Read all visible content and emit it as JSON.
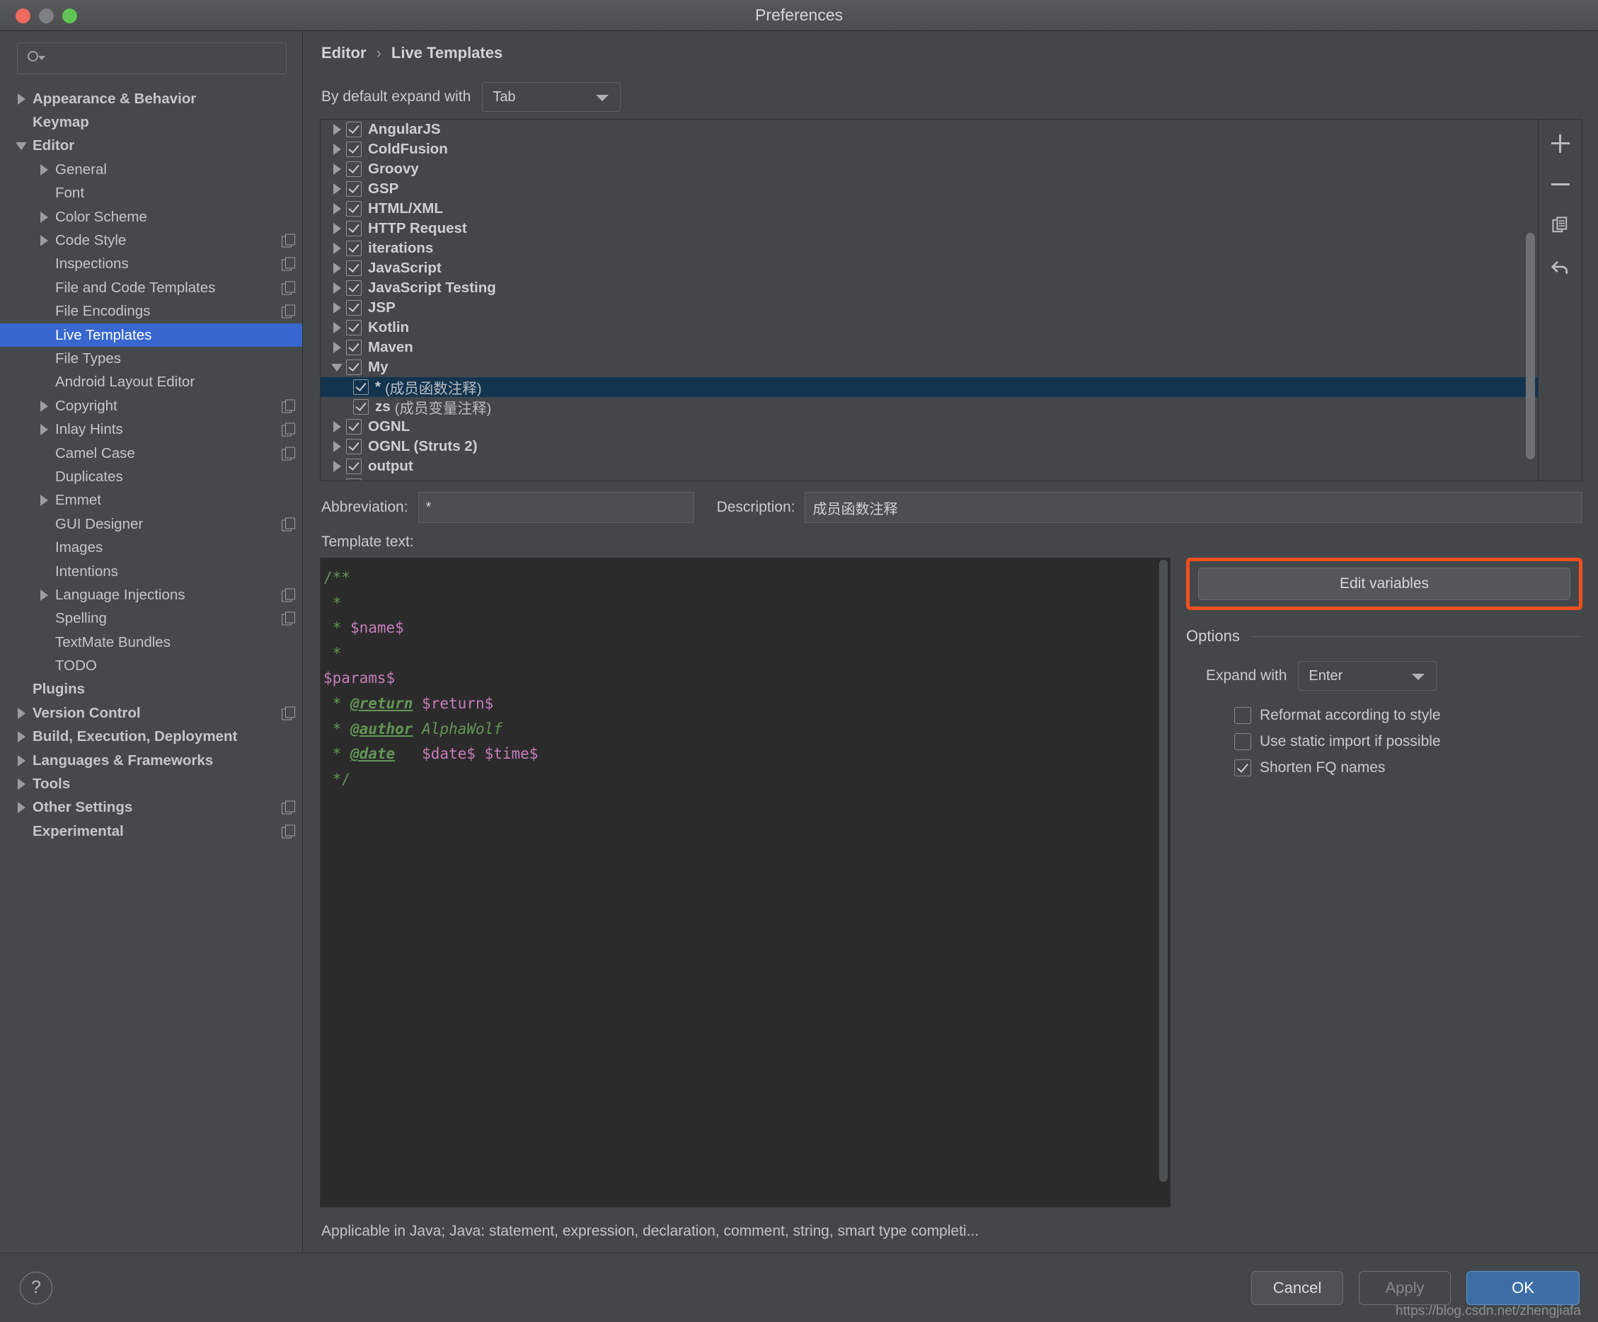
{
  "window": {
    "title": "Preferences",
    "traffic": [
      "close",
      "minimize",
      "zoom"
    ]
  },
  "sidebar": {
    "search": {
      "value": "",
      "placeholder": ""
    },
    "items": [
      {
        "label": "Appearance & Behavior",
        "indent": 0,
        "arrow": "right",
        "bold": true,
        "copy": false,
        "selected": false
      },
      {
        "label": "Keymap",
        "indent": 0,
        "arrow": "none",
        "bold": true,
        "copy": false,
        "selected": false
      },
      {
        "label": "Editor",
        "indent": 0,
        "arrow": "down",
        "bold": true,
        "copy": false,
        "selected": false
      },
      {
        "label": "General",
        "indent": 1,
        "arrow": "right",
        "bold": false,
        "copy": false,
        "selected": false
      },
      {
        "label": "Font",
        "indent": 1,
        "arrow": "none",
        "bold": false,
        "copy": false,
        "selected": false
      },
      {
        "label": "Color Scheme",
        "indent": 1,
        "arrow": "right",
        "bold": false,
        "copy": false,
        "selected": false
      },
      {
        "label": "Code Style",
        "indent": 1,
        "arrow": "right",
        "bold": false,
        "copy": true,
        "selected": false
      },
      {
        "label": "Inspections",
        "indent": 1,
        "arrow": "none",
        "bold": false,
        "copy": true,
        "selected": false
      },
      {
        "label": "File and Code Templates",
        "indent": 1,
        "arrow": "none",
        "bold": false,
        "copy": true,
        "selected": false
      },
      {
        "label": "File Encodings",
        "indent": 1,
        "arrow": "none",
        "bold": false,
        "copy": true,
        "selected": false
      },
      {
        "label": "Live Templates",
        "indent": 1,
        "arrow": "none",
        "bold": false,
        "copy": false,
        "selected": true
      },
      {
        "label": "File Types",
        "indent": 1,
        "arrow": "none",
        "bold": false,
        "copy": false,
        "selected": false
      },
      {
        "label": "Android Layout Editor",
        "indent": 1,
        "arrow": "none",
        "bold": false,
        "copy": false,
        "selected": false
      },
      {
        "label": "Copyright",
        "indent": 1,
        "arrow": "right",
        "bold": false,
        "copy": true,
        "selected": false
      },
      {
        "label": "Inlay Hints",
        "indent": 1,
        "arrow": "right",
        "bold": false,
        "copy": true,
        "selected": false
      },
      {
        "label": "Camel Case",
        "indent": 1,
        "arrow": "none",
        "bold": false,
        "copy": true,
        "selected": false
      },
      {
        "label": "Duplicates",
        "indent": 1,
        "arrow": "none",
        "bold": false,
        "copy": false,
        "selected": false
      },
      {
        "label": "Emmet",
        "indent": 1,
        "arrow": "right",
        "bold": false,
        "copy": false,
        "selected": false
      },
      {
        "label": "GUI Designer",
        "indent": 1,
        "arrow": "none",
        "bold": false,
        "copy": true,
        "selected": false
      },
      {
        "label": "Images",
        "indent": 1,
        "arrow": "none",
        "bold": false,
        "copy": false,
        "selected": false
      },
      {
        "label": "Intentions",
        "indent": 1,
        "arrow": "none",
        "bold": false,
        "copy": false,
        "selected": false
      },
      {
        "label": "Language Injections",
        "indent": 1,
        "arrow": "right",
        "bold": false,
        "copy": true,
        "selected": false
      },
      {
        "label": "Spelling",
        "indent": 1,
        "arrow": "none",
        "bold": false,
        "copy": true,
        "selected": false
      },
      {
        "label": "TextMate Bundles",
        "indent": 1,
        "arrow": "none",
        "bold": false,
        "copy": false,
        "selected": false
      },
      {
        "label": "TODO",
        "indent": 1,
        "arrow": "none",
        "bold": false,
        "copy": false,
        "selected": false
      },
      {
        "label": "Plugins",
        "indent": 0,
        "arrow": "none",
        "bold": true,
        "copy": false,
        "selected": false
      },
      {
        "label": "Version Control",
        "indent": 0,
        "arrow": "right",
        "bold": true,
        "copy": true,
        "selected": false
      },
      {
        "label": "Build, Execution, Deployment",
        "indent": 0,
        "arrow": "right",
        "bold": true,
        "copy": false,
        "selected": false
      },
      {
        "label": "Languages & Frameworks",
        "indent": 0,
        "arrow": "right",
        "bold": true,
        "copy": false,
        "selected": false
      },
      {
        "label": "Tools",
        "indent": 0,
        "arrow": "right",
        "bold": true,
        "copy": false,
        "selected": false
      },
      {
        "label": "Other Settings",
        "indent": 0,
        "arrow": "right",
        "bold": true,
        "copy": true,
        "selected": false
      },
      {
        "label": "Experimental",
        "indent": 0,
        "arrow": "none",
        "bold": true,
        "copy": true,
        "selected": false
      }
    ]
  },
  "breadcrumb": {
    "parent": "Editor",
    "separator": "›",
    "current": "Live Templates"
  },
  "expand_default": {
    "label": "By default expand with",
    "value": "Tab"
  },
  "template_list": {
    "rows": [
      {
        "label": "AngularJS",
        "desc": "",
        "arrow": "right",
        "checked": true,
        "child": false,
        "selected": false
      },
      {
        "label": "ColdFusion",
        "desc": "",
        "arrow": "right",
        "checked": true,
        "child": false,
        "selected": false
      },
      {
        "label": "Groovy",
        "desc": "",
        "arrow": "right",
        "checked": true,
        "child": false,
        "selected": false
      },
      {
        "label": "GSP",
        "desc": "",
        "arrow": "right",
        "checked": true,
        "child": false,
        "selected": false
      },
      {
        "label": "HTML/XML",
        "desc": "",
        "arrow": "right",
        "checked": true,
        "child": false,
        "selected": false
      },
      {
        "label": "HTTP Request",
        "desc": "",
        "arrow": "right",
        "checked": true,
        "child": false,
        "selected": false
      },
      {
        "label": "iterations",
        "desc": "",
        "arrow": "right",
        "checked": true,
        "child": false,
        "selected": false
      },
      {
        "label": "JavaScript",
        "desc": "",
        "arrow": "right",
        "checked": true,
        "child": false,
        "selected": false
      },
      {
        "label": "JavaScript Testing",
        "desc": "",
        "arrow": "right",
        "checked": true,
        "child": false,
        "selected": false
      },
      {
        "label": "JSP",
        "desc": "",
        "arrow": "right",
        "checked": true,
        "child": false,
        "selected": false
      },
      {
        "label": "Kotlin",
        "desc": "",
        "arrow": "right",
        "checked": true,
        "child": false,
        "selected": false
      },
      {
        "label": "Maven",
        "desc": "",
        "arrow": "right",
        "checked": true,
        "child": false,
        "selected": false
      },
      {
        "label": "My",
        "desc": "",
        "arrow": "down",
        "checked": true,
        "child": false,
        "selected": false
      },
      {
        "label": "*",
        "desc": "(成员函数注释)",
        "arrow": "none",
        "checked": true,
        "child": true,
        "selected": true
      },
      {
        "label": "zs",
        "desc": "(成员变量注释)",
        "arrow": "none",
        "checked": true,
        "child": true,
        "selected": false
      },
      {
        "label": "OGNL",
        "desc": "",
        "arrow": "right",
        "checked": true,
        "child": false,
        "selected": false
      },
      {
        "label": "OGNL (Struts 2)",
        "desc": "",
        "arrow": "right",
        "checked": true,
        "child": false,
        "selected": false
      },
      {
        "label": "output",
        "desc": "",
        "arrow": "right",
        "checked": true,
        "child": false,
        "selected": false
      }
    ],
    "tools": [
      "add-icon",
      "remove-icon",
      "duplicate-icon",
      "revert-icon"
    ]
  },
  "abbreviation": {
    "label": "Abbreviation:",
    "value": "*"
  },
  "description": {
    "label": "Description:",
    "value": "成员函数注释"
  },
  "template_text": {
    "label": "Template text:",
    "lines": [
      {
        "segments": [
          {
            "t": "/**",
            "c": "cm"
          }
        ]
      },
      {
        "segments": [
          {
            "t": " *",
            "c": "cm"
          }
        ]
      },
      {
        "segments": [
          {
            "t": " * ",
            "c": "cm"
          },
          {
            "t": "$name$",
            "c": "var"
          }
        ]
      },
      {
        "segments": [
          {
            "t": " *",
            "c": "cm"
          }
        ]
      },
      {
        "segments": [
          {
            "t": "$params$",
            "c": "var"
          }
        ]
      },
      {
        "segments": [
          {
            "t": " * ",
            "c": "cm"
          },
          {
            "t": "@return",
            "c": "tag"
          },
          {
            "t": " ",
            "c": "cm"
          },
          {
            "t": "$return$",
            "c": "var"
          }
        ]
      },
      {
        "segments": [
          {
            "t": " * ",
            "c": "cm"
          },
          {
            "t": "@author",
            "c": "tag"
          },
          {
            "t": " ",
            "c": "cm"
          },
          {
            "t": "AlphaWolf",
            "c": "itl"
          }
        ]
      },
      {
        "segments": [
          {
            "t": " * ",
            "c": "cm"
          },
          {
            "t": "@date",
            "c": "tag"
          },
          {
            "t": "   ",
            "c": "cm"
          },
          {
            "t": "$date$ $time$",
            "c": "var"
          }
        ]
      },
      {
        "segments": [
          {
            "t": " */",
            "c": "cm"
          }
        ]
      }
    ]
  },
  "edit_variables": {
    "label": "Edit variables",
    "highlight_color": "#f1501e"
  },
  "options": {
    "title": "Options",
    "expand_with": {
      "label": "Expand with",
      "value": "Enter"
    },
    "checkboxes": [
      {
        "label": "Reformat according to style",
        "checked": false
      },
      {
        "label": "Use static import if possible",
        "checked": false
      },
      {
        "label": "Shorten FQ names",
        "checked": true
      }
    ]
  },
  "applicable": "Applicable in Java; Java: statement, expression, declaration, comment, string, smart type completi...",
  "footer": {
    "help": "?",
    "cancel": "Cancel",
    "apply": "Apply",
    "ok": "OK"
  },
  "watermark": "https://blog.csdn.net/zhengjiafa"
}
